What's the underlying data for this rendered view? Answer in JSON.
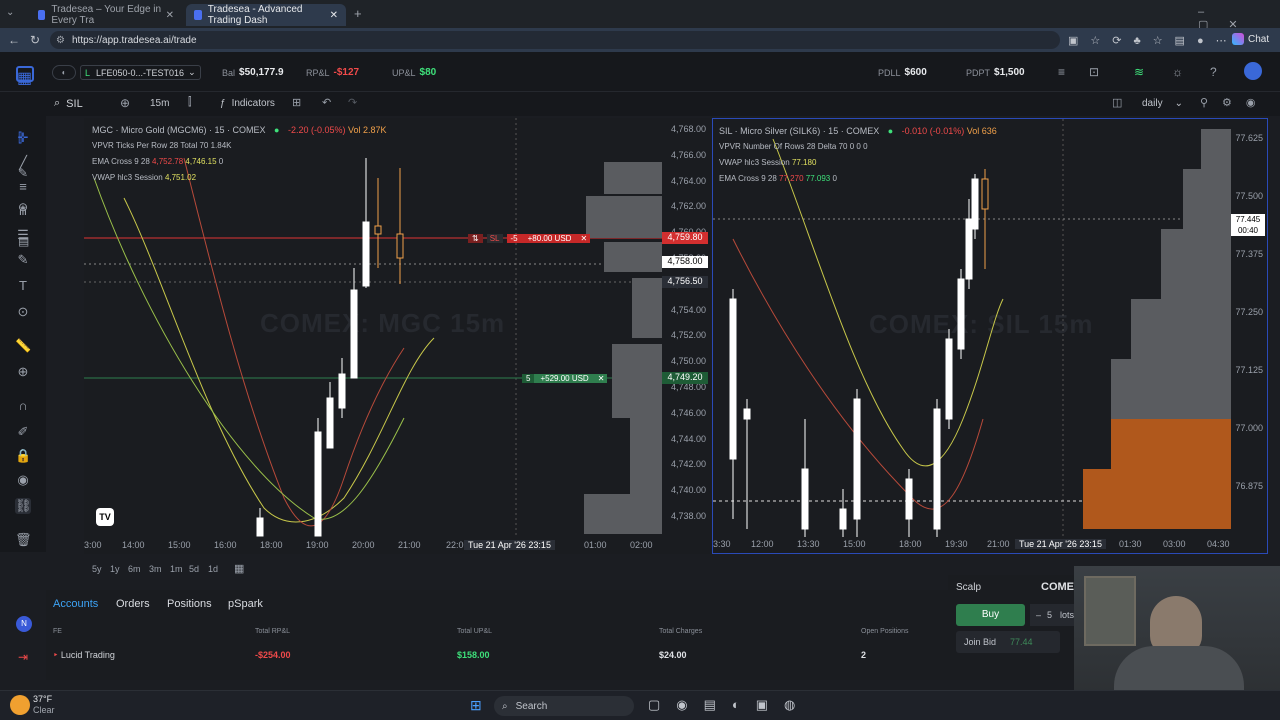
{
  "browser": {
    "tabs": [
      {
        "label": "Tradesea – Your Edge in Every Tra"
      },
      {
        "label": "Tradesea - Advanced Trading Dash"
      }
    ],
    "url": "https://app.tradesea.ai/trade",
    "chat_label": "Chat"
  },
  "header": {
    "account": "LFE050-0...-TEST016",
    "bal_label": "Bal",
    "bal_value": "$50,177.9",
    "rpl_label": "RP&L",
    "rpl_value": "-$127",
    "upl_label": "UP&L",
    "upl_value": "$80",
    "pdll_label": "PDLL",
    "pdll_value": "$600",
    "pdpt_label": "PDPT",
    "pdpt_value": "$1,500"
  },
  "toolbar": {
    "symbol": "SIL",
    "timeframe": "15m",
    "indicators_label": "Indicators",
    "period": "daily"
  },
  "chart_left": {
    "title": "MGC · Micro Gold (MGCM6) · 15 · COMEX",
    "change": "-2.20 (-0.05%)",
    "vol": "Vol 2.87K",
    "vpvr": "VPVR Ticks Per Row 28 Total 70  1.84K",
    "ema": "EMA Cross 9 28",
    "ema_v1": "4,752.78",
    "ema_v2": "4,746.15",
    "ema_v3": "0",
    "vwap": "VWAP hlc3 Session",
    "vwap_v": "4,751.02",
    "watermark": "COMEX: MGC 15m",
    "sl_order": {
      "qty": "-5",
      "text": "+80.00 USD",
      "tag": "SL",
      "price": "4,759.80"
    },
    "tp_order": {
      "qty": "5",
      "text": "+529.00 USD",
      "price": "4,749.20"
    },
    "last_price": "4,758.00",
    "cursor_price": "4,756.50",
    "price_ticks": [
      "4,768.00",
      "4,766.00",
      "4,764.00",
      "4,762.00",
      "4,760.00",
      "4,758.00",
      "4,756.00",
      "4,754.00",
      "4,752.00",
      "4,750.00",
      "4,748.00",
      "4,746.00",
      "4,744.00",
      "4,742.00",
      "4,740.00",
      "4,738.00"
    ],
    "time_ticks": [
      "3:00",
      "14:00",
      "15:00",
      "16:00",
      "18:00",
      "19:00",
      "20:00",
      "21:00",
      "22:0"
    ],
    "cursor_time": "Tue 21 Apr '26  23:15",
    "time_ticks_right": [
      "01:00",
      "02:00"
    ]
  },
  "chart_right": {
    "title": "SIL · Micro Silver (SILK6) · 15 · COMEX",
    "change": "-0.010 (-0.01%)",
    "vol": "Vol 636",
    "vpvr": "VPVR Number Of Rows 28 Delta 70  0  0  0",
    "vwap": "VWAP hlc3 Session",
    "vwap_v": "77.180",
    "ema": "EMA Cross 9 28",
    "ema_v1": "77.270",
    "ema_v2": "77.093",
    "ema_v3": "0",
    "watermark": "COMEX: SIL 15m",
    "last_price": "77.445",
    "countdown": "00:40",
    "price_ticks": [
      "77.625",
      "77.500",
      "77.375",
      "77.250",
      "77.125",
      "77.000",
      "76.875"
    ],
    "time_ticks": [
      "3:30",
      "12:00",
      "13:30",
      "15:00",
      "18:00",
      "19:30",
      "21:00"
    ],
    "cursor_time": "Tue 21 Apr '26  23:15",
    "time_ticks_right": [
      "01:30",
      "03:00",
      "04:30"
    ]
  },
  "timeframes": [
    "5y",
    "1y",
    "6m",
    "3m",
    "1m",
    "5d",
    "1d"
  ],
  "bottom": {
    "tabs": [
      "Accounts",
      "Orders",
      "Positions",
      "pSpark"
    ],
    "headers": [
      "FE",
      "Total RP&L",
      "Total UP&L",
      "Total Charges",
      "Open Positions"
    ],
    "row": {
      "name": "Lucid Trading",
      "rpl": "-$254.00",
      "upl": "$158.00",
      "charges": "$24.00",
      "positions": "2"
    }
  },
  "scalp": {
    "title": "Scalp",
    "exchange": "COME",
    "buy_label": "Buy",
    "qty": "5",
    "qty_unit": "lots",
    "join_bid_label": "Join Bid",
    "join_bid_price": "77.44"
  },
  "taskbar": {
    "weather_temp": "37°F",
    "weather_desc": "Clear",
    "search_label": "Search"
  }
}
